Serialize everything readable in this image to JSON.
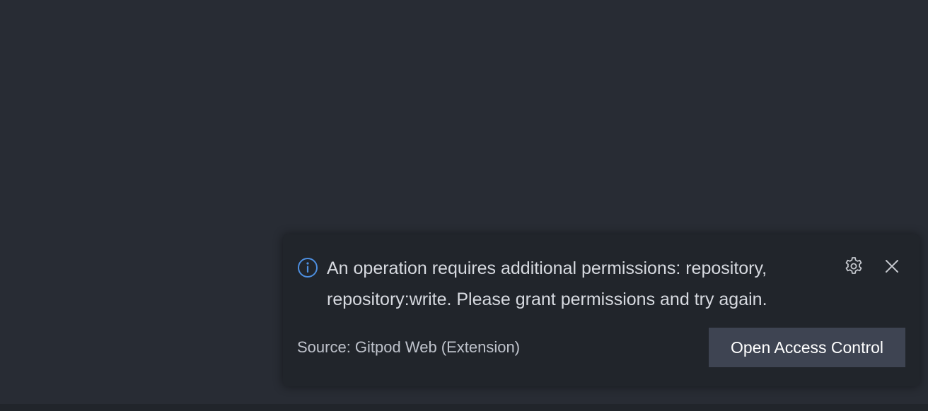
{
  "notification": {
    "icon": "info-icon",
    "message": "An operation requires additional permissions: repository, repository:write. Please grant permissions and try again.",
    "source": "Source: Gitpod Web (Extension)",
    "primary_action_label": "Open Access Control",
    "settings_icon": "gear-icon",
    "close_icon": "close-icon"
  },
  "colors": {
    "editor_background": "#282c34",
    "toast_background": "#21252b",
    "info_accent": "#4d8fe0",
    "button_background": "#3e4452"
  }
}
